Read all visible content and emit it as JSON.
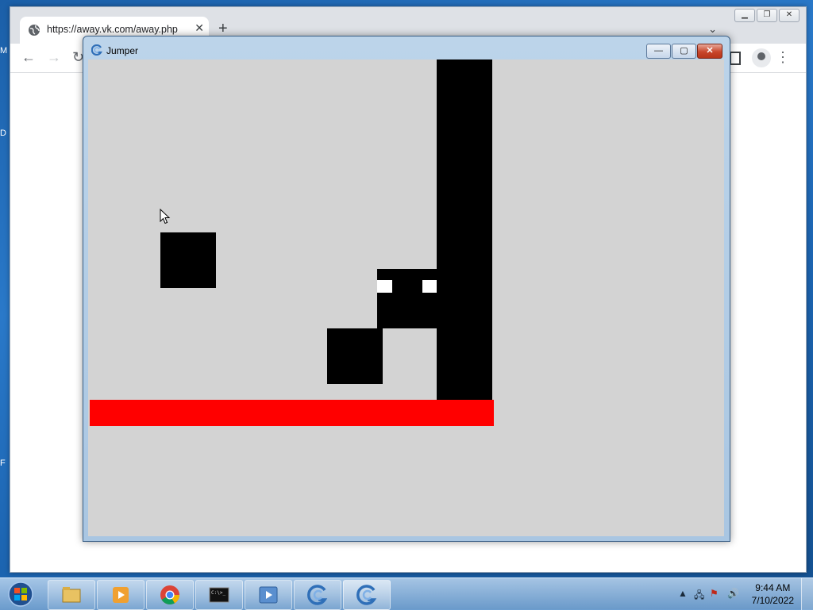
{
  "browser": {
    "tab_title": "https://away.vk.com/away.php",
    "new_tab_icon": "plus-icon",
    "window_controls": [
      "minimize",
      "restore",
      "close"
    ]
  },
  "jumper_window": {
    "title": "Jumper",
    "controls": {
      "minimize": "—",
      "maximize": "▢",
      "close": "✕"
    }
  },
  "game": {
    "background_color": "#d3d3d3",
    "block_color": "#000000",
    "floor_color": "#ff0000",
    "eye_color": "#ffffff"
  },
  "taskbar": {
    "apps": [
      "windows-explorer",
      "windows-media-player",
      "google-chrome",
      "command-prompt",
      "video-player",
      "jumper-app",
      "jumper-app"
    ],
    "clock": {
      "time": "9:44 AM",
      "date": "7/10/2022"
    }
  }
}
